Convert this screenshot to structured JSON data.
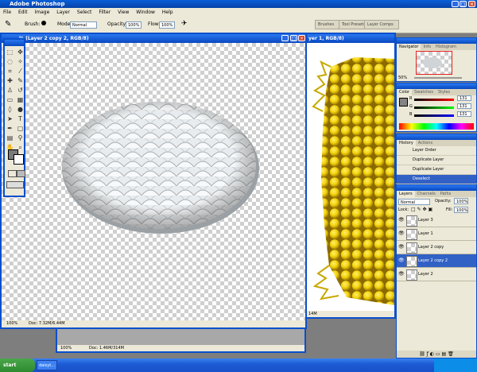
{
  "app": {
    "title": "Adobe Photoshop"
  },
  "menu": [
    "File",
    "Edit",
    "Image",
    "Layer",
    "Select",
    "Filter",
    "View",
    "Window",
    "Help"
  ],
  "options": {
    "brush_label": "Brush:",
    "mode_label": "Mode:",
    "mode_value": "Normal",
    "opacity_label": "Opacity:",
    "opacity_value": "100%",
    "flow_label": "Flow:",
    "flow_value": "100%"
  },
  "palette_well": [
    "Brushes",
    "Tool Presets",
    "Layer Comps"
  ],
  "doc_front": {
    "title": "% (Layer 2 copy 2, RGB/8)",
    "zoom": "100%",
    "doc_size": "Doc: 7.32M/6.44M"
  },
  "doc_back": {
    "title": "yer 1, RGB/8)",
    "doc_size": "14M"
  },
  "doc_min": {
    "zoom": "100%",
    "doc_size": "Doc: 1.46M/314M"
  },
  "navigator": {
    "tabs": [
      "Navigator",
      "Info",
      "Histogram"
    ],
    "zoom": "50%"
  },
  "color": {
    "tabs": [
      "Color",
      "Swatches",
      "Styles"
    ],
    "channels": [
      {
        "name": "R",
        "value": "131"
      },
      {
        "name": "G",
        "value": "131"
      },
      {
        "name": "B",
        "value": "131"
      }
    ]
  },
  "history": {
    "tabs": [
      "History",
      "Actions"
    ],
    "items": [
      "Layer Order",
      "Duplicate Layer",
      "Duplicate Layer",
      "Deselect"
    ]
  },
  "layers": {
    "tabs": [
      "Layers",
      "Channels",
      "Paths"
    ],
    "blend": "Normal",
    "opacity_label": "Opacity:",
    "opacity_value": "100%",
    "lock_label": "Lock:",
    "fill_label": "Fill:",
    "fill_value": "100%",
    "items": [
      "Layer 3",
      "Layer 1",
      "Layer 2 copy",
      "Layer 2 copy 2",
      "Layer 2"
    ]
  },
  "taskbar": {
    "start": "start",
    "task": "daisyt..."
  },
  "colors": {
    "accent": "#0a4fcc",
    "selection": "#3161c5",
    "flower": "#f2d20c"
  }
}
